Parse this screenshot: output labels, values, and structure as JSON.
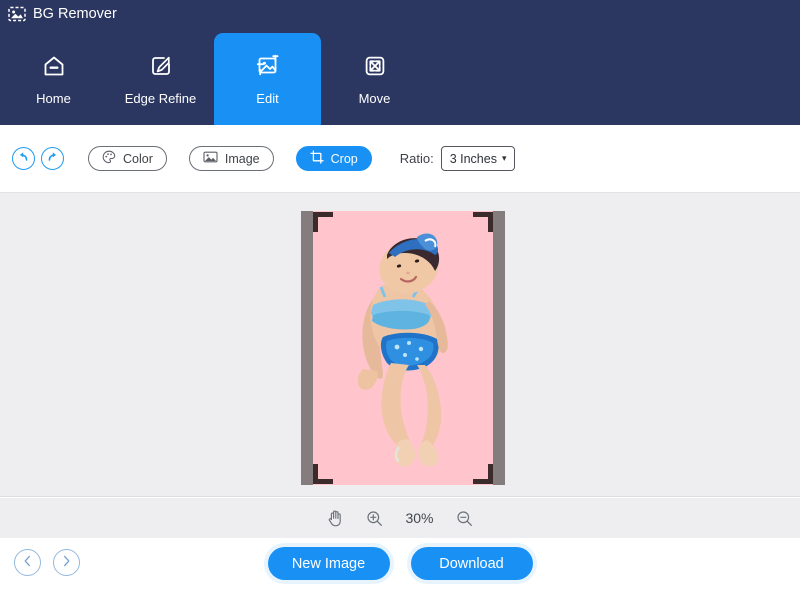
{
  "app": {
    "title": "BG Remover",
    "logo_icon": "image-dashed-icon",
    "accent_color": "#1890f4",
    "header_color": "#2b3760"
  },
  "nav": {
    "items": [
      {
        "label": "Home",
        "icon": "home-icon",
        "active": false
      },
      {
        "label": "Edge Refine",
        "icon": "pen-square-icon",
        "active": false
      },
      {
        "label": "Edit",
        "icon": "image-crop-icon",
        "active": true
      },
      {
        "label": "Move",
        "icon": "move-arrows-icon",
        "active": false
      }
    ]
  },
  "toolbar": {
    "undo_icon": "undo-arrow-icon",
    "redo_icon": "redo-arrow-icon",
    "color_label": "Color",
    "color_icon": "palette-icon",
    "image_label": "Image",
    "image_icon": "picture-icon",
    "crop_label": "Crop",
    "crop_icon": "crop-frame-icon",
    "ratio_label": "Ratio:",
    "ratio_value": "3 Inches",
    "ratio_caret": "▾"
  },
  "canvas": {
    "background": "#eeeef0",
    "frame_color": "#857d7d",
    "photo_background": "#ffc4cc",
    "crop_handle_color": "#3b2b2b",
    "subject": "toddler in blue swimsuit on pink background"
  },
  "zoombar": {
    "hand_icon": "hand-tool-icon",
    "zoom_in_icon": "zoom-in-icon",
    "zoom_out_icon": "zoom-out-icon",
    "zoom_level": "30%"
  },
  "footer": {
    "prev_icon": "chevron-left-icon",
    "next_icon": "chevron-right-icon",
    "new_image_label": "New Image",
    "download_label": "Download"
  }
}
